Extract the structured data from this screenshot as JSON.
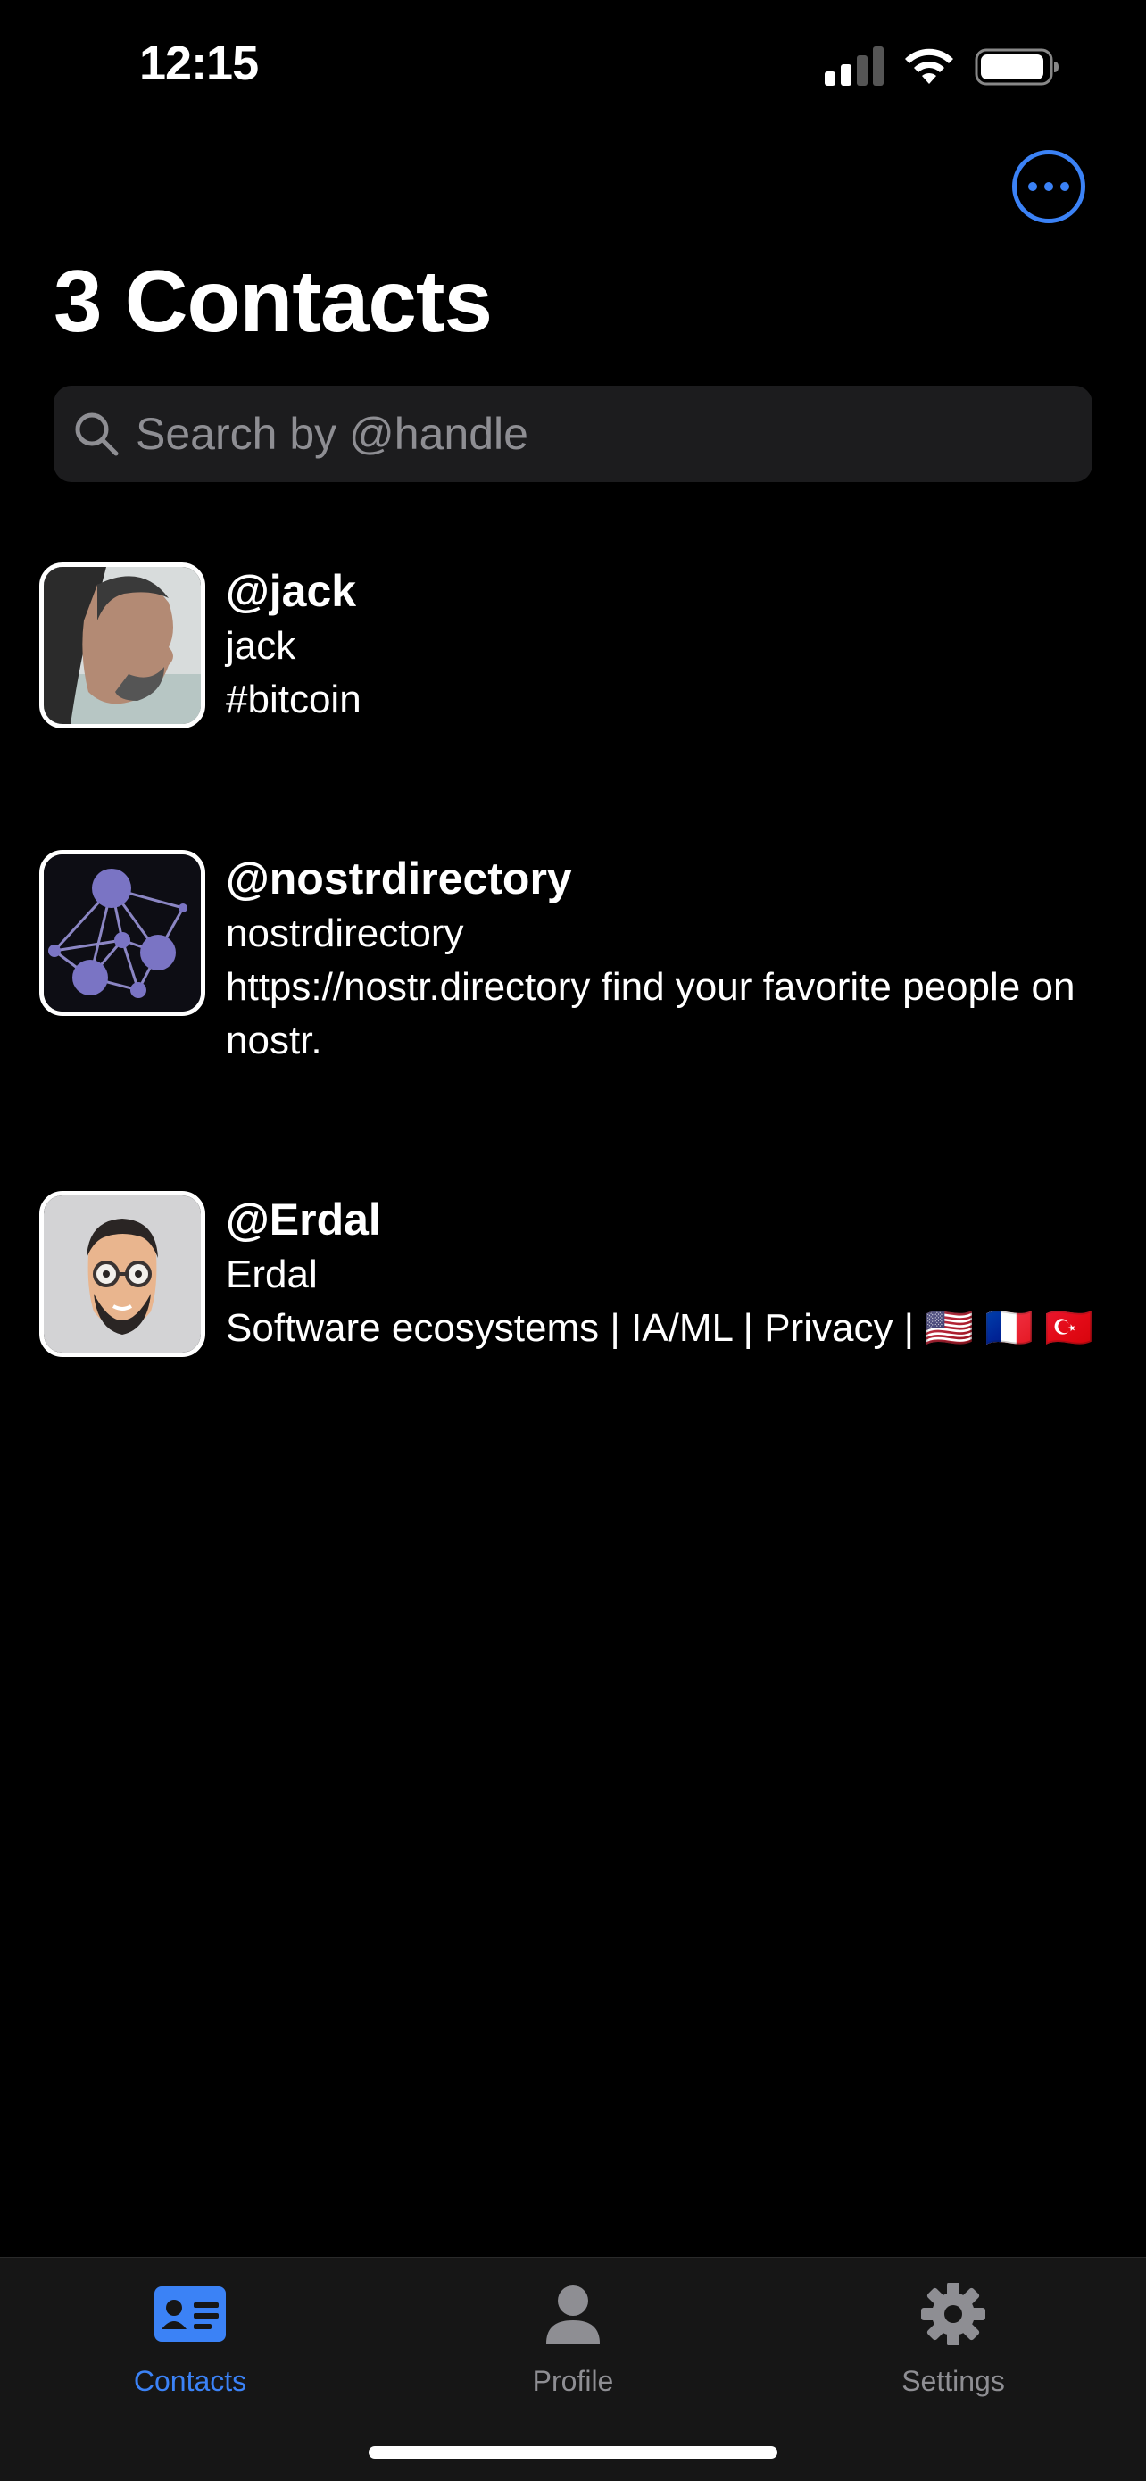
{
  "status_bar": {
    "time": "12:15"
  },
  "header": {
    "title": "3 Contacts",
    "more_icon": "ellipsis-circle-icon"
  },
  "search": {
    "placeholder": "Search by @handle",
    "value": ""
  },
  "contacts": [
    {
      "handle": "@jack",
      "name": "jack",
      "bio": "#bitcoin"
    },
    {
      "handle": "@nostrdirectory",
      "name": "nostrdirectory",
      "bio": "https://nostr.directory find your favorite people on nostr."
    },
    {
      "handle": "@Erdal",
      "name": "Erdal",
      "bio": "Software ecosystems | IA/ML | Privacy | 🇺🇸 🇫🇷 🇹🇷"
    }
  ],
  "tabs": [
    {
      "label": "Contacts",
      "icon": "contact-card-icon",
      "active": true
    },
    {
      "label": "Profile",
      "icon": "person-icon",
      "active": false
    },
    {
      "label": "Settings",
      "icon": "gear-icon",
      "active": false
    }
  ],
  "colors": {
    "accent": "#3b82f6",
    "background": "#000000",
    "tab_inactive": "#8e8e93"
  }
}
